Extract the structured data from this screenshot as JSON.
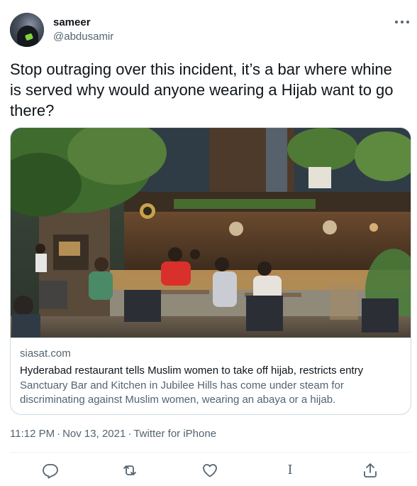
{
  "author": {
    "display_name": "sameer",
    "handle": "@abdusamir",
    "avatar_icon": "user-avatar"
  },
  "tweet": {
    "text": "Stop outraging over this incident, it’s a bar where whine is served why would anyone wearing a Hijab want to go there?"
  },
  "card": {
    "domain": "siasat.com",
    "title": "Hyderabad restaurant tells Muslim women to take off hijab, restricts entry",
    "description": "Sanctuary Bar and Kitchen in Jubilee Hills has come under steam for discriminating against Muslim women, wearing an abaya or a hijab."
  },
  "meta": {
    "time": "11:12 PM",
    "separator": "·",
    "date": "Nov 13, 2021",
    "source": "Twitter for iPhone"
  },
  "actions": {
    "reply_icon": "reply-icon",
    "retweet_icon": "retweet-icon",
    "like_icon": "heart-icon",
    "cursor_glyph": "I",
    "share_icon": "share-icon"
  },
  "colors": {
    "text_primary": "#0f1419",
    "text_secondary": "#536471",
    "border": "#cfd9de"
  }
}
